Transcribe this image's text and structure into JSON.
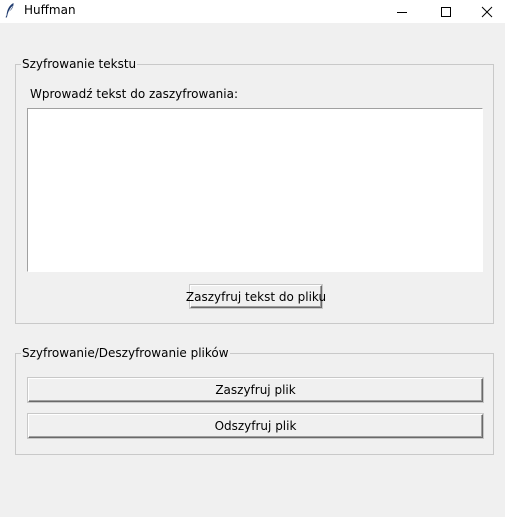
{
  "window": {
    "title": "Huffman",
    "icon": "feather-icon",
    "controls": [
      "minimize-icon",
      "maximize-icon",
      "close-icon"
    ]
  },
  "text_encryption": {
    "legend": "Szyfrowanie tekstu",
    "prompt": "Wprowadź tekst do zaszyfrowania:",
    "text_value": "",
    "encrypt_button": "Zaszyfruj tekst do pliku"
  },
  "file_operations": {
    "legend": "Szyfrowanie/Deszyfrowanie plików",
    "encrypt_button": "Zaszyfruj plik",
    "decrypt_button": "Odszyfruj plik"
  }
}
